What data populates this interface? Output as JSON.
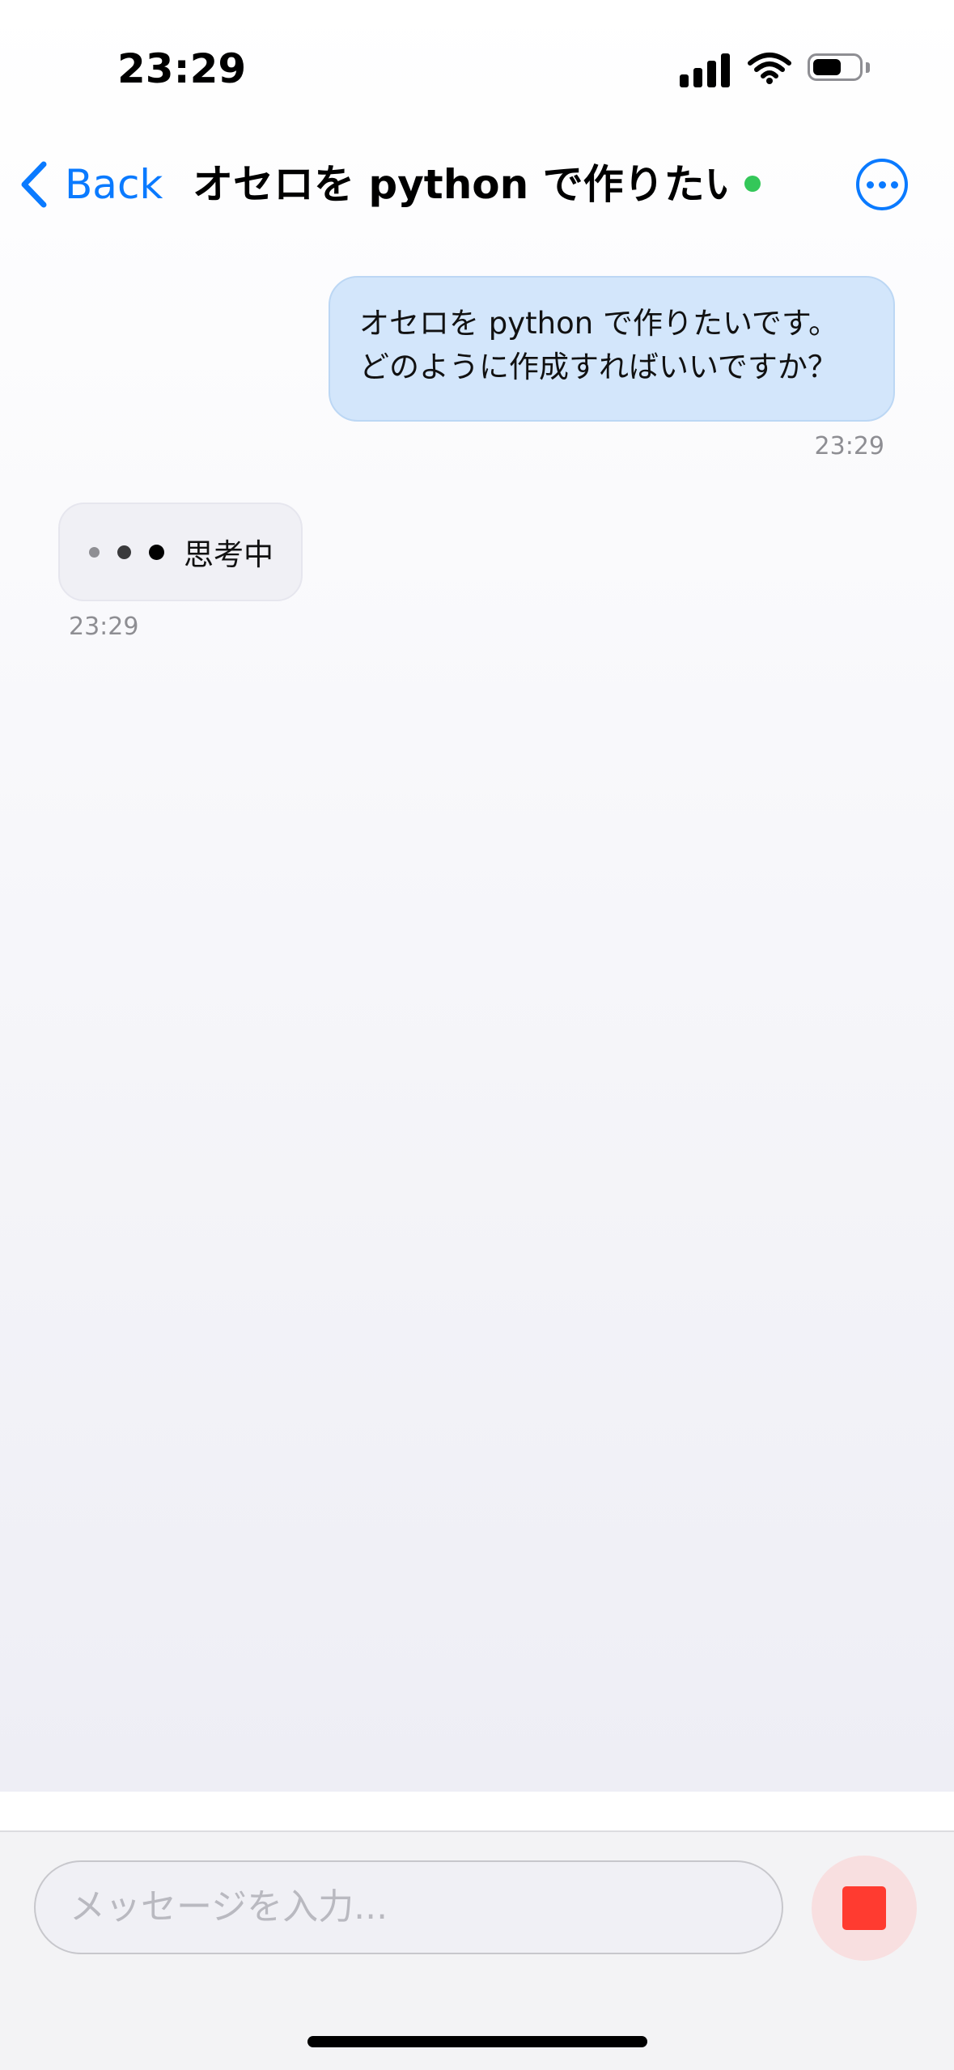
{
  "status_bar": {
    "time": "23:29",
    "battery_level": 0.6
  },
  "nav": {
    "back_label": "Back",
    "title": "オセロを python で作りたいで",
    "online": true,
    "online_color": "#34c759",
    "more_icon": "ellipsis-circle-icon"
  },
  "messages": [
    {
      "role": "user",
      "lines": [
        "オセロを python で作りたいです。",
        "どのように作成すればいいですか？"
      ],
      "time": "23:29"
    },
    {
      "role": "assistant",
      "status": "思考中",
      "time": "23:29"
    }
  ],
  "composer": {
    "placeholder": "メッセージを入力...",
    "stop_icon": "stop-icon"
  },
  "colors": {
    "accent": "#0a7aff",
    "user_bubble": "#d3e6fb",
    "stop": "#ff3b30"
  }
}
